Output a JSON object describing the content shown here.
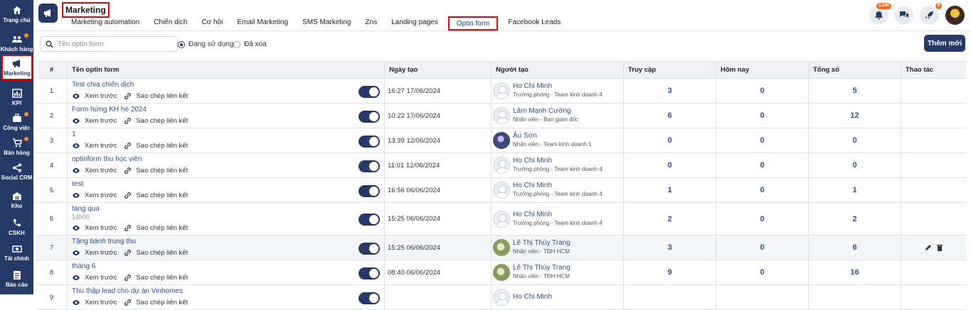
{
  "sidebar": {
    "items": [
      {
        "label": "Trang chủ",
        "icon": "home-icon",
        "dot": false
      },
      {
        "label": "Khách hàng",
        "icon": "users-icon",
        "dot": true
      },
      {
        "label": "Marketing",
        "icon": "megaphone-icon",
        "dot": false,
        "active": true
      },
      {
        "label": "KPI",
        "icon": "chart-icon",
        "dot": false
      },
      {
        "label": "Công việc",
        "icon": "briefcase-icon",
        "dot": true
      },
      {
        "label": "Bán hàng",
        "icon": "cart-icon",
        "dot": true
      },
      {
        "label": "Social CRM",
        "icon": "share-icon",
        "dot": false
      },
      {
        "label": "Kho",
        "icon": "warehouse-icon",
        "dot": false
      },
      {
        "label": "CSKH",
        "icon": "phone-icon",
        "dot": false
      },
      {
        "label": "Tài chính",
        "icon": "money-icon",
        "dot": false
      },
      {
        "label": "Báo cáo",
        "icon": "report-icon",
        "dot": false
      }
    ]
  },
  "header": {
    "title": "Marketing",
    "tabs": [
      "Marketing automation",
      "Chiến dịch",
      "Cơ hội",
      "Email Marketing",
      "SMS Marketing",
      "Zns",
      "Landing pages",
      "Optin form",
      "Facebook Leads"
    ],
    "active_tab": "Optin form",
    "notification_badge": "2,248",
    "rocket_badge": "9"
  },
  "toolbar": {
    "search_placeholder": "Tên optin form",
    "filter_active": "Đang sử dụng",
    "filter_deleted": "Đã xóa",
    "add_label": "Thêm mới"
  },
  "table": {
    "headers": [
      "#",
      "Tên optin form",
      "Ngày tạo",
      "Người tạo",
      "Truy cập",
      "Hôm nay",
      "Tổng số",
      "Thao tác"
    ],
    "preview_label": "Xem trước",
    "copy_label": "Sao chép liên kết",
    "rows": [
      {
        "no": "1",
        "name": "Test chia chiến dịch",
        "sub": "",
        "date": "16:27  17/06/2024",
        "person": "Ho Chi Minh",
        "role": "Trưởng phòng - Team kinh doanh 4",
        "avatar": "default",
        "visits": "3",
        "today": "0",
        "total": "5"
      },
      {
        "no": "2",
        "name": "Form hứng KH hè 2024",
        "sub": "",
        "date": "10:22  17/06/2024",
        "person": "Lâm Mạnh Cường",
        "role": "Nhân viên - Ban giám đốc",
        "avatar": "default",
        "visits": "6",
        "today": "0",
        "total": "12"
      },
      {
        "no": "3",
        "name": "1",
        "sub": "",
        "date": "13:39  12/06/2024",
        "person": "Âu Sơn",
        "role": "Nhân viên - Team kinh doanh 1",
        "avatar": "photo1",
        "visits": "0",
        "today": "0",
        "total": "0"
      },
      {
        "no": "4",
        "name": "optinform thu học viên",
        "sub": "",
        "date": "11:01  12/06/2024",
        "person": "Ho Chi Minh",
        "role": "Trưởng phòng - Team kinh doanh 4",
        "avatar": "default",
        "visits": "0",
        "today": "0",
        "total": "0"
      },
      {
        "no": "5",
        "name": "test",
        "sub": "",
        "date": "16:56  06/06/2024",
        "person": "Ho Chi Minh",
        "role": "Trưởng phòng - Team kinh doanh 4",
        "avatar": "default",
        "visits": "1",
        "today": "0",
        "total": "1"
      },
      {
        "no": "6",
        "name": "tang qua",
        "sub": "14h00",
        "date": "15:25  06/06/2024",
        "person": "Ho Chi Minh",
        "role": "Trưởng phòng - Team kinh doanh 4",
        "avatar": "default",
        "visits": "2",
        "today": "0",
        "total": "2"
      },
      {
        "no": "7",
        "name": "Tặng bánh trung thu",
        "sub": "",
        "date": "15:25  06/06/2024",
        "person": "Lê Thị Thùy Trang",
        "role": "Nhân viên - TĐH HCM",
        "avatar": "photo2",
        "visits": "3",
        "today": "0",
        "total": "6",
        "highlight": true
      },
      {
        "no": "8",
        "name": "tháng 6",
        "sub": "",
        "date": "08:40  06/06/2024",
        "person": "Lê Thị Thùy Trang",
        "role": "Nhân viên - TĐH HCM",
        "avatar": "photo2",
        "visits": "9",
        "today": "0",
        "total": "16"
      },
      {
        "no": "9",
        "name": "Thu thập lead cho dự án Vinhomes",
        "sub": "",
        "date": "",
        "person": "Ho Chi Minh",
        "role": "",
        "avatar": "default",
        "visits": "",
        "today": "",
        "total": ""
      }
    ]
  },
  "colors": {
    "primary": "#253a66",
    "accent": "#f08a24",
    "link": "#2f4f8f",
    "highlight_border": "#ee0000"
  }
}
